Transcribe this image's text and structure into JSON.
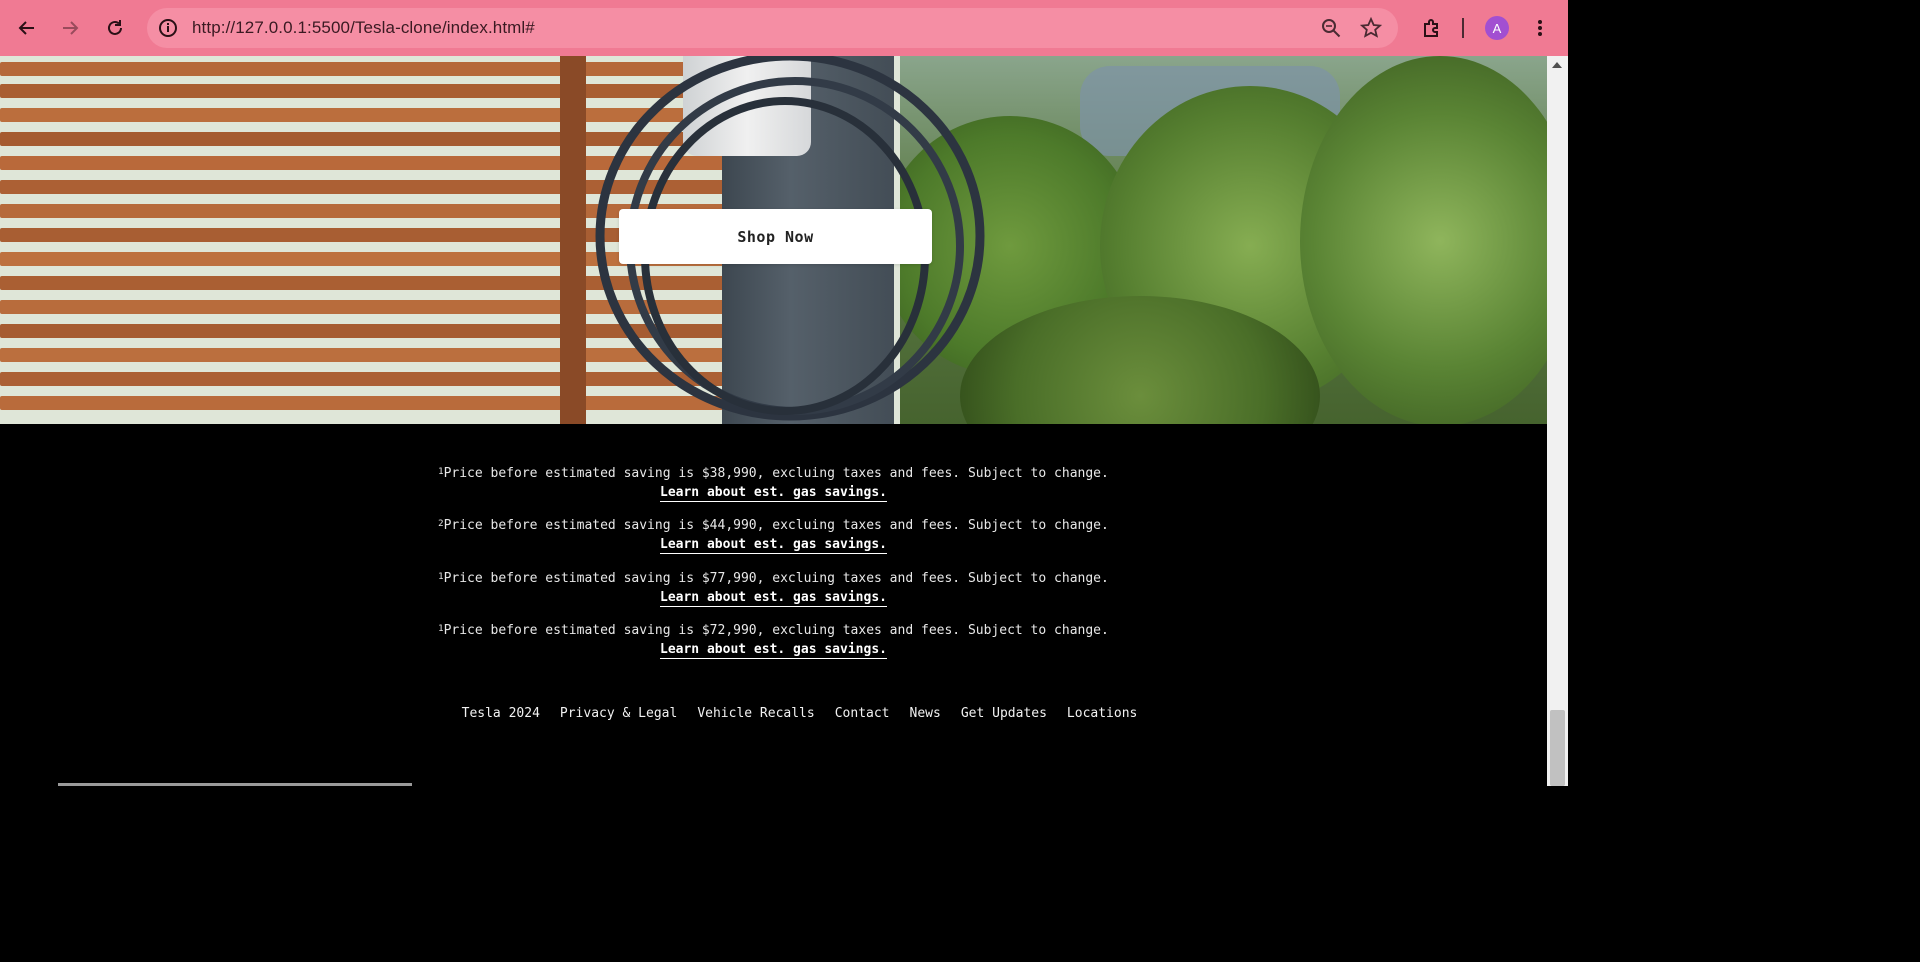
{
  "browser": {
    "url": "http://127.0.0.1:5500/Tesla-clone/index.html#",
    "profile_initial": "A",
    "chrome_color": "#f07a93"
  },
  "hero": {
    "button_label": "Shop Now"
  },
  "notes": [
    {
      "marker": "1",
      "text": "Price before estimated saving is $38,990, excluing taxes and fees. Subject to change.",
      "link": "Learn about est. gas savings."
    },
    {
      "marker": "2",
      "text": "Price before estimated saving is $44,990, excluing taxes and fees. Subject to change.",
      "link": "Learn about est. gas savings."
    },
    {
      "marker": "1",
      "text": "Price before estimated saving is $77,990, excluing taxes and fees. Subject to change.",
      "link": "Learn about est. gas savings."
    },
    {
      "marker": "1",
      "text": "Price before estimated saving is $72,990, excluing taxes and fees. Subject to change.",
      "link": "Learn about est. gas savings."
    }
  ],
  "footer_links": [
    "Tesla 2024",
    "Privacy & Legal",
    "Vehicle Recalls",
    "Contact",
    "News",
    "Get Updates",
    "Locations"
  ]
}
